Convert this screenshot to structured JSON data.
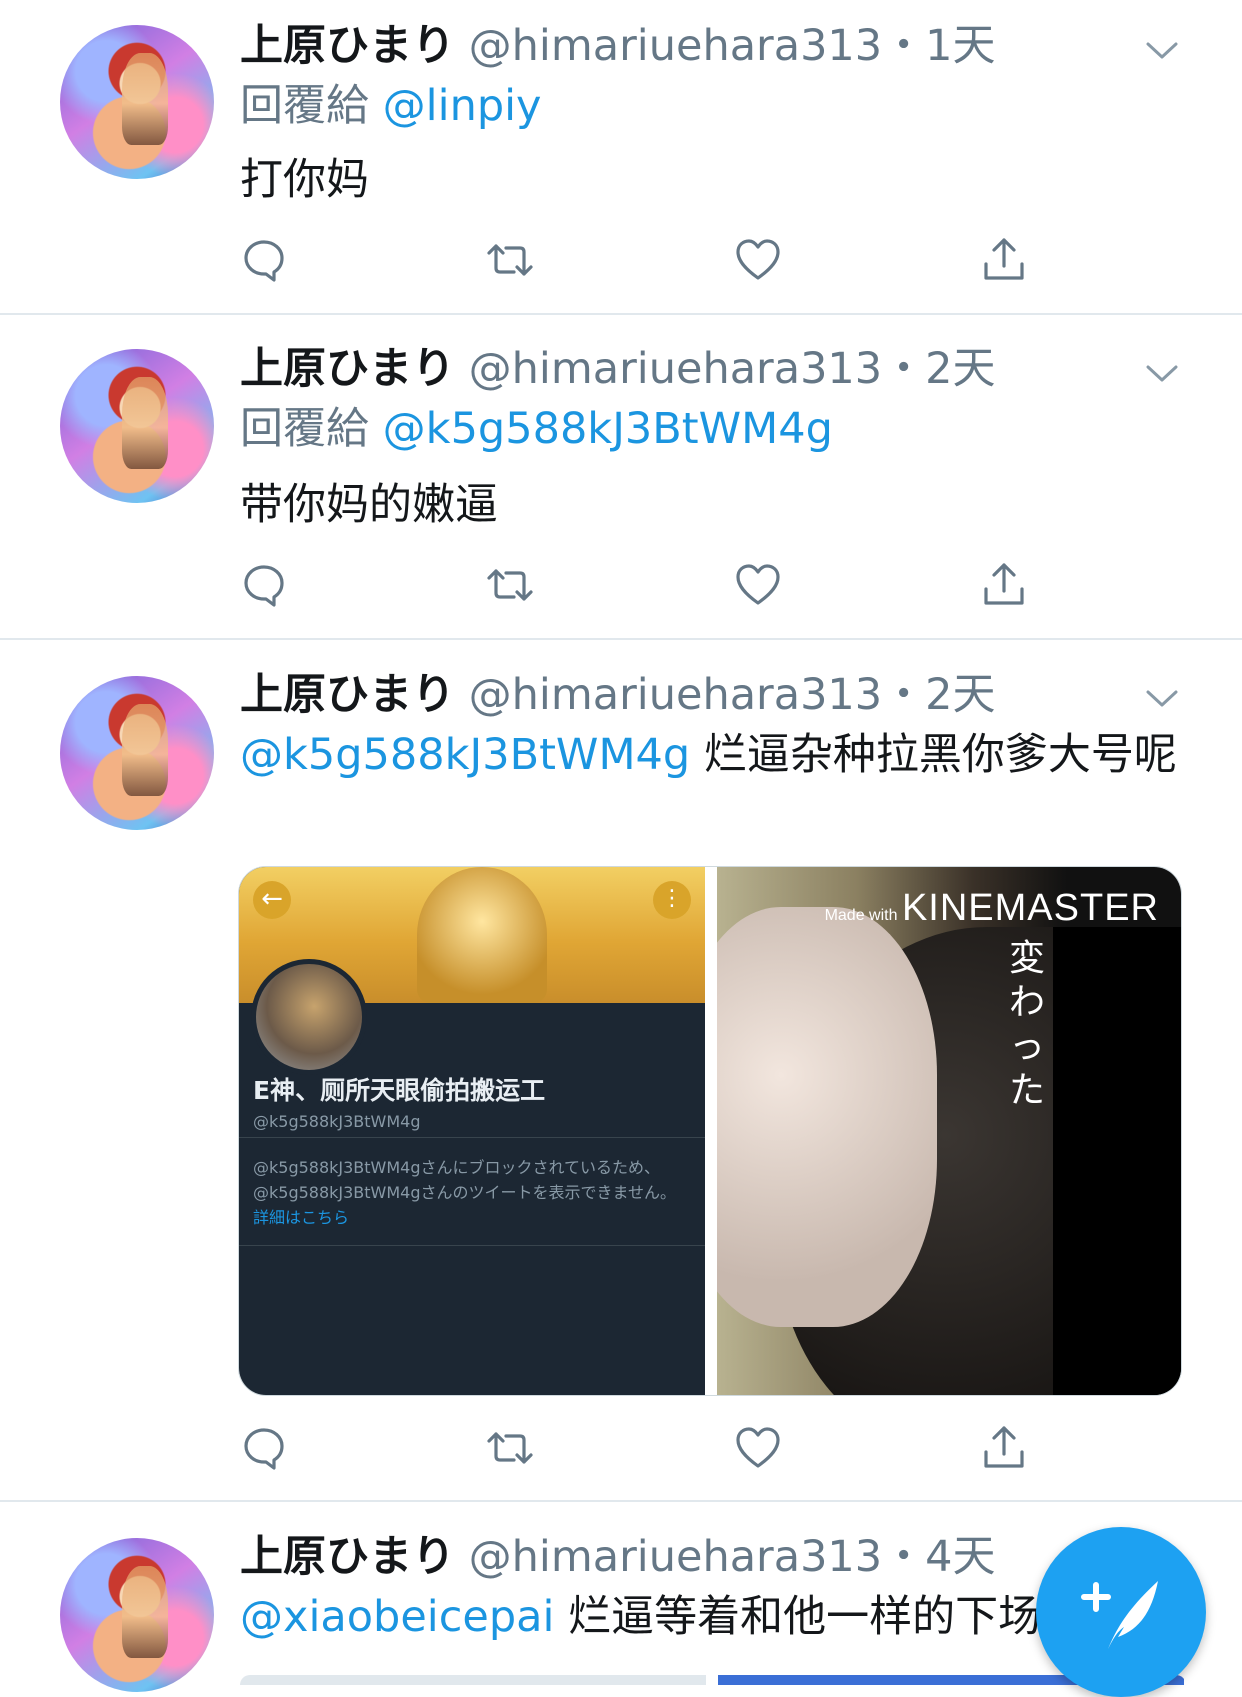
{
  "colors": {
    "accent": "#1da1f2",
    "link": "#1b95e0",
    "muted": "#657786",
    "divider": "#e1e8ed"
  },
  "tweets": [
    {
      "name": "上原ひまり",
      "meta": "@himariuehara313・1天",
      "reply_label": "回覆給",
      "reply_to": "@linpiy",
      "text": "打你妈"
    },
    {
      "name": "上原ひまり",
      "meta": "@himariuehara313・2天",
      "reply_label": "回覆給",
      "reply_to": "@k5g588kJ3BtWM4g",
      "text": "带你妈的嫩逼"
    },
    {
      "name": "上原ひまり",
      "meta": "@himariuehara313・2天",
      "mention": "@k5g588kJ3BtWM4g",
      "text": "烂逼杂种拉黑你爹大号呢",
      "media": {
        "left": {
          "profile_name": "E神、厕所天眼偷拍搬运工",
          "profile_handle": "@k5g588kJ3BtWM4g",
          "blocked_text": "@k5g588kJ3BtWM4gさんにブロックされているため、@k5g588kJ3BtWM4gさんのツイートを表示できません。",
          "blocked_link": "詳細はこちら"
        },
        "right": {
          "watermark_small": "Made with",
          "watermark_big": "KINEMASTER",
          "vertical_text": "変わった"
        }
      }
    },
    {
      "name": "上原ひまり",
      "meta": "@himariuehara313・4天",
      "mention": "@xiaobeicepai",
      "text": "烂逼等着和他一样的下场"
    }
  ],
  "icons": {
    "reply": "reply-icon",
    "retweet": "retweet-icon",
    "like": "heart-icon",
    "share": "share-icon",
    "chevron": "chevron-down-icon",
    "compose": "compose-tweet-icon"
  }
}
